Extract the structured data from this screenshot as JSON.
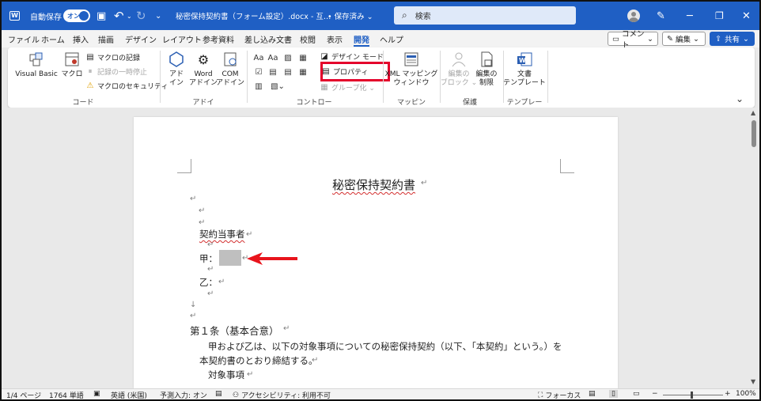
{
  "titlebar": {
    "autosave_label": "自動保存",
    "autosave_toggle": "オン",
    "doc_title": "秘密保持契約書（フォーム設定）.docx  -  互…",
    "saved_status": "• 保存済み ⌄",
    "search_placeholder": "検索"
  },
  "tabs": [
    "ファイル",
    "ホーム",
    "挿入",
    "描画",
    "デザイン",
    "レイアウト",
    "参考資料",
    "差し込み文書",
    "校閲",
    "表示",
    "開発",
    "ヘルプ"
  ],
  "active_tab": "開発",
  "ribbon_right": {
    "comment": "コメント",
    "edit": "編集",
    "share": "共有"
  },
  "ribbon": {
    "code_group": {
      "visual_basic": "Visual Basic",
      "macro": "マクロ",
      "record_macro": "マクロの記録",
      "pause_recording": "記録の一時停止",
      "macro_security": "マクロのセキュリティ",
      "label": "コード"
    },
    "addin_group": {
      "addin": "アド\nイン",
      "word_addin": "Word\nアドイン",
      "com_addin": "COM\nアドイン",
      "label": "アドイン"
    },
    "control_group": {
      "design_mode": "デザイン モード",
      "properties": "プロパティ",
      "group": "グループ化 ⌄",
      "label": "コントロール"
    },
    "mapping_group": {
      "xml_mapping": "XML マッピング\nウィンドウ",
      "label": "マッピング"
    },
    "protect_group": {
      "block_authors": "編集の\nブロック ⌄",
      "restrict_editing": "編集の\n制限",
      "label": "保護"
    },
    "template_group": {
      "doc_template": "文書\nテンプレート",
      "label": "テンプレート"
    }
  },
  "document": {
    "title": "秘密保持契約書",
    "parties_heading": "契約当事者",
    "party_a": "甲：",
    "party_b": "乙：",
    "article1": "第１条（基本合意）",
    "body_line1": "甲および乙は、以下の対象事項についての秘密保持契約（以下、「本契約」という。）を",
    "body_line2": "本契約書のとおり締結する。",
    "body_line3": "対象事項",
    "para_mark": "↵",
    "arrow_mark": "↓"
  },
  "status": {
    "page": "1/4 ページ",
    "words": "1764 単語",
    "language": "英語 (米国)",
    "predict": "予測入力: オン",
    "accessibility": "アクセシビリティ: 利用不可",
    "focus": "フォーカス",
    "zoom": "100%",
    "zoom_minus": "−",
    "zoom_plus": "+"
  },
  "colors": {
    "accent": "#1f5fc4",
    "highlight": "#e4002b",
    "arrow": "#e8141c"
  }
}
